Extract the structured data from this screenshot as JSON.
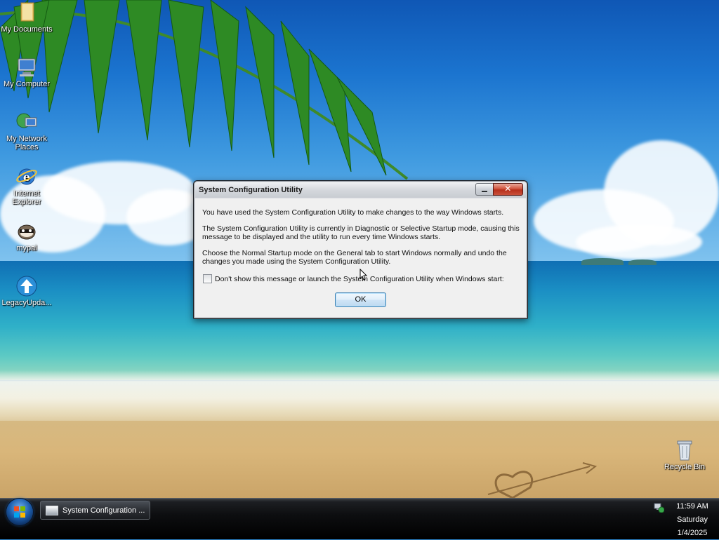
{
  "desktop": {
    "icons": [
      {
        "label": "My Documents"
      },
      {
        "label": "My Computer"
      },
      {
        "label": "My Network Places"
      },
      {
        "label": "Internet Explorer"
      },
      {
        "label": "mypal"
      },
      {
        "label": "LegacyUpda..."
      },
      {
        "label": "Recycle Bin"
      }
    ]
  },
  "dialog": {
    "title": "System Configuration Utility",
    "close_glyph": "✕",
    "messages": [
      "You have used the System Configuration Utility to make changes to the way Windows starts.",
      "The System Configuration Utility is currently in Diagnostic or Selective Startup mode, causing this message to be displayed and the utility to run every time Windows starts.",
      "Choose the Normal Startup mode on the General tab to start Windows normally and undo the changes you made using the System Configuration Utility."
    ],
    "checkbox_label": "Don't show this message or launch the System Configuration Utility when Windows start:",
    "checkbox_checked": false,
    "ok_label": "OK"
  },
  "taskbar": {
    "window_button_label": "System Configuration ...",
    "clock": {
      "time": "11:59 AM",
      "day": "Saturday",
      "date": "1/4/2025"
    }
  },
  "colors": {
    "title_text": "#1a1a1a",
    "close_button": "#c9503b",
    "ok_button_border": "#3c7fb1",
    "taskbar_bg": "#000000"
  }
}
